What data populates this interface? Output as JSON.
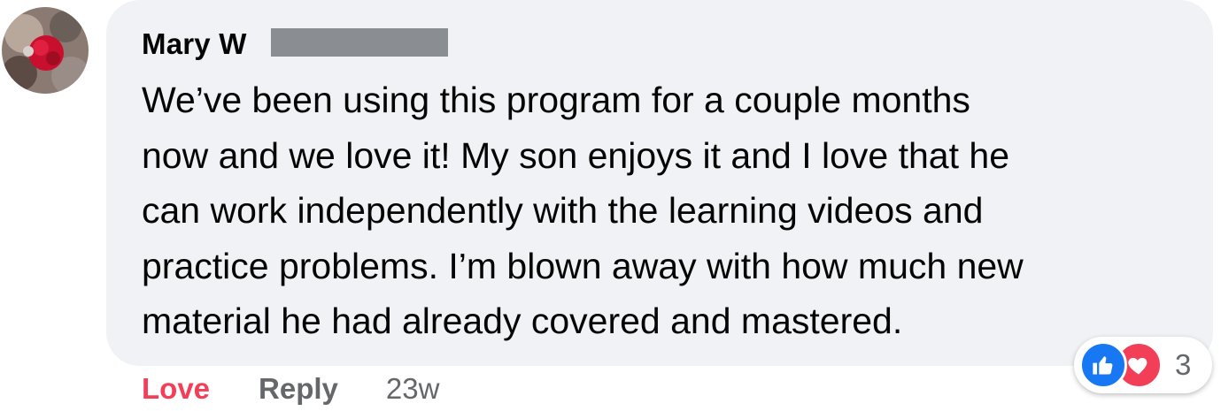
{
  "comment": {
    "author": "Mary W",
    "text_lines": [
      "We’ve been using this program for a couple months",
      "now and we love it! My son enjoys it and I love that he",
      "can work independently with the learning videos and",
      "practice problems. I’m blown away with how much new",
      "material he had already covered and mastered."
    ]
  },
  "actions": {
    "love_label": "Love",
    "reply_label": "Reply",
    "timestamp": "23w"
  },
  "reactions": {
    "count": "3",
    "icons": [
      "like-icon",
      "heart-icon"
    ]
  },
  "colors": {
    "bubble_bg": "#f0f2f5",
    "love_active": "#f33e58",
    "like_blue": "#1877f2",
    "secondary_text": "#65676b",
    "redaction_gray": "#8a8d91"
  }
}
